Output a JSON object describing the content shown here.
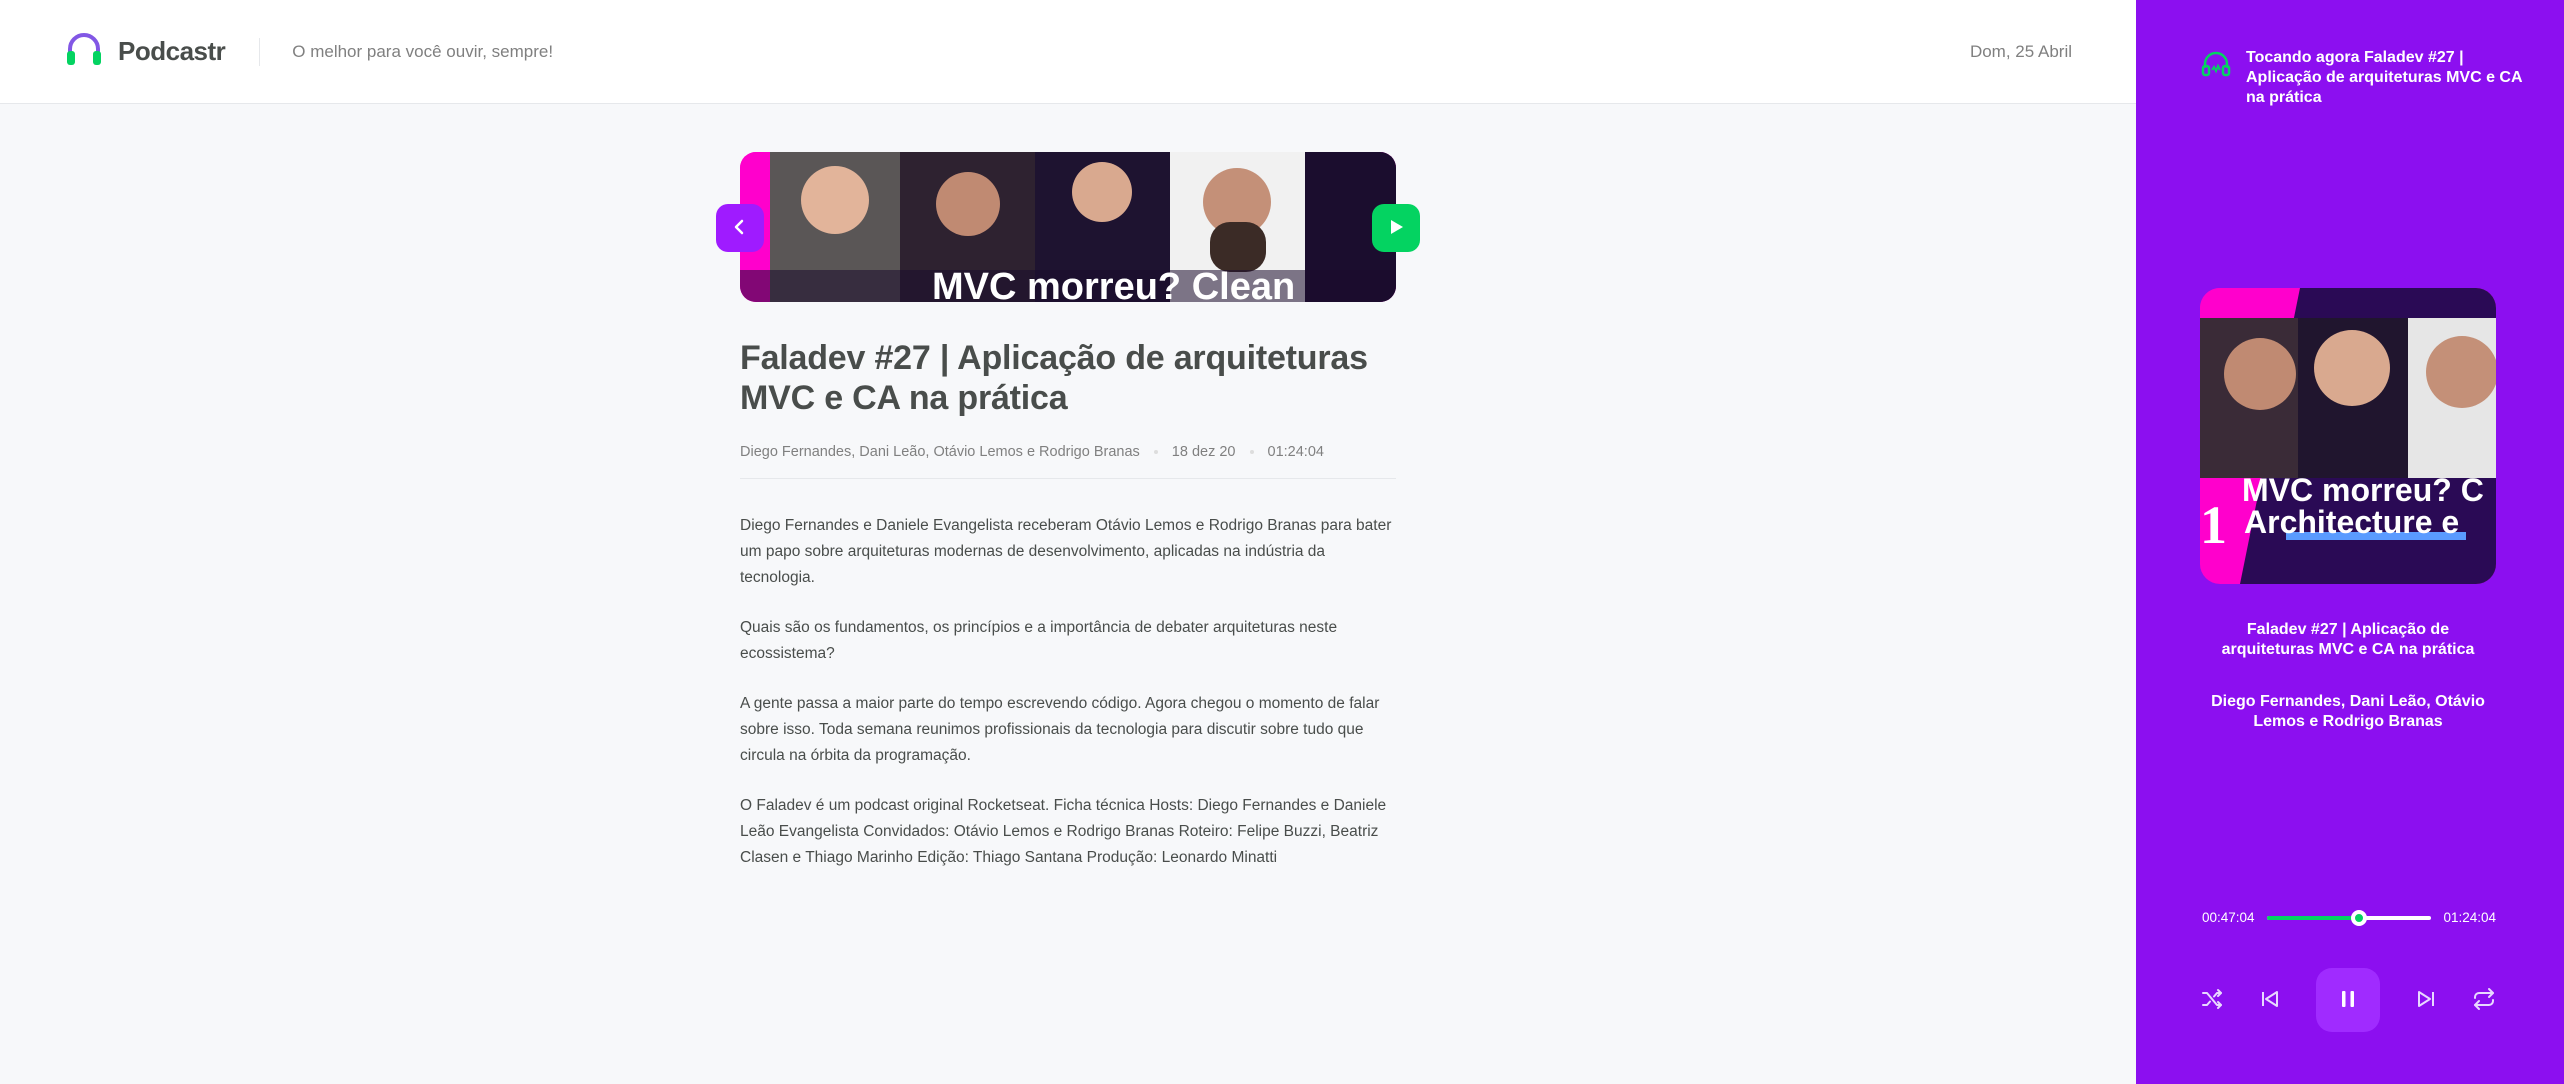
{
  "header": {
    "app_name": "Podcastr",
    "tagline": "O melhor para você ouvir, sempre!",
    "date": "Dom, 25 Abril"
  },
  "episode": {
    "thumbnail_caption": "MVC morreu? Clean",
    "title": "Faladev #27 | Aplicação de arquiteturas MVC e CA na prática",
    "members": "Diego Fernandes, Dani Leão, Otávio Lemos e Rodrigo Branas",
    "published_at": "18 dez 20",
    "duration": "01:24:04",
    "description": [
      "Diego Fernandes e Daniele Evangelista receberam Otávio Lemos e Rodrigo Branas para bater um papo sobre arquiteturas modernas de desenvolvimento, aplicadas na indústria da tecnologia.",
      "Quais são os fundamentos, os princípios e a importância de debater arquiteturas neste ecossistema?",
      "A gente passa a maior parte do tempo escrevendo código. Agora chegou o momento de falar sobre isso. Toda semana reunimos profissionais da tecnologia para discutir sobre tudo que circula na órbita da programação.",
      "O Faladev é um podcast original Rocketseat.  Ficha técnica Hosts: Diego Fernandes e Daniele Leão Evangelista Convidados: Otávio Lemos  e Rodrigo Branas Roteiro: Felipe Buzzi, Beatriz Clasen e Thiago Marinho Edição: Thiago Santana Produção: Leonardo Minatti"
    ]
  },
  "player": {
    "now_playing": "Tocando agora Faladev #27 | Aplicação de arquiteturas MVC e CA na prática",
    "cover_line1": "MVC morreu? C",
    "cover_line2": "Architecture e",
    "cover_number": "1",
    "title": "Faladev #27 | Aplicação de arquiteturas MVC e CA na prática",
    "members": "Diego Fernandes, Dani Leão, Otávio Lemos e Rodrigo Branas",
    "current_time": "00:47:04",
    "total_time": "01:24:04",
    "progress": 0.56,
    "controls": [
      "shuffle-icon",
      "previous-icon",
      "pause-icon",
      "next-icon",
      "repeat-icon"
    ]
  },
  "colors": {
    "accent_purple": "#8c0ff0",
    "accent_green": "#04d361",
    "text": "#494d4b",
    "muted": "#808080"
  }
}
